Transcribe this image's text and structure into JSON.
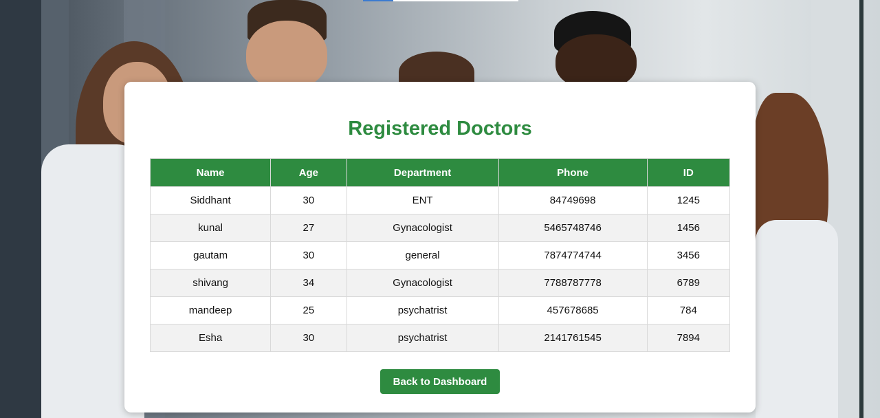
{
  "page": {
    "title": "Registered Doctors"
  },
  "table": {
    "headers": [
      "Name",
      "Age",
      "Department",
      "Phone",
      "ID"
    ],
    "rows": [
      [
        "Siddhant",
        "30",
        "ENT",
        "84749698",
        "1245"
      ],
      [
        "kunal",
        "27",
        "Gynacologist",
        "5465748746",
        "1456"
      ],
      [
        "gautam",
        "30",
        "general",
        "7874774744",
        "3456"
      ],
      [
        "shivang",
        "34",
        "Gynacologist",
        "7788787778",
        "6789"
      ],
      [
        "mandeep",
        "25",
        "psychatrist",
        "457678685",
        "784"
      ],
      [
        "Esha",
        "30",
        "psychatrist",
        "2141761545",
        "7894"
      ]
    ]
  },
  "actions": {
    "back_label": "Back to Dashboard"
  },
  "colors": {
    "accent": "#2e8b40",
    "row_alt": "#f2f2f2",
    "card": "#ffffff"
  }
}
